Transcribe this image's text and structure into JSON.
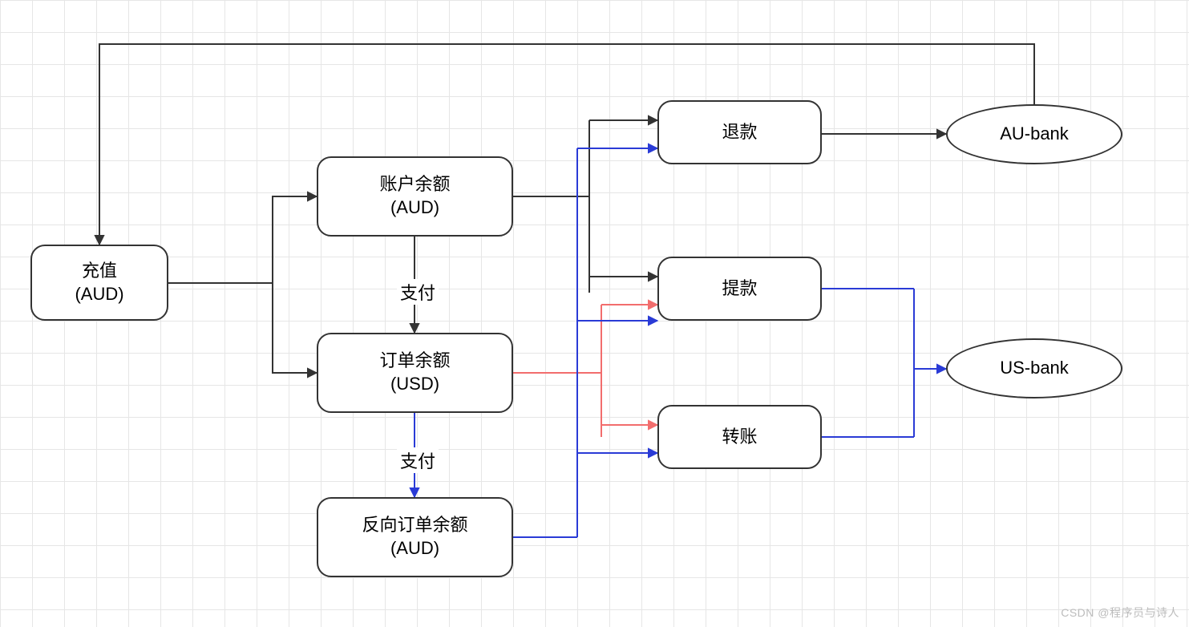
{
  "nodes": {
    "recharge": {
      "line1": "充值",
      "line2": "(AUD)"
    },
    "acct_balance": {
      "line1": "账户余额",
      "line2": "(AUD)"
    },
    "order_balance": {
      "line1": "订单余额",
      "line2": "(USD)"
    },
    "rev_order": {
      "line1": "反向订单余额",
      "line2": "(AUD)"
    },
    "refund": {
      "line1": "退款"
    },
    "withdraw": {
      "line1": "提款"
    },
    "transfer": {
      "line1": "转账"
    },
    "au_bank": {
      "line1": "AU-bank"
    },
    "us_bank": {
      "line1": "US-bank"
    }
  },
  "edge_labels": {
    "pay1": "支付",
    "pay2": "支付"
  },
  "colors": {
    "black": "#333333",
    "blue": "#2a3bd6",
    "red": "#f26d6d"
  },
  "watermark": "CSDN @程序员与诗人"
}
